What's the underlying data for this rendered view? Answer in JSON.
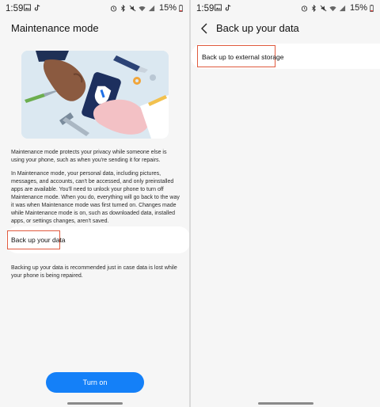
{
  "status": {
    "time": "1:59",
    "battery": "15%"
  },
  "left": {
    "title": "Maintenance mode",
    "description_1": "Maintenance mode protects your privacy while someone else is using your phone, such as when you're sending it for repairs.",
    "description_2": "In Maintenance mode, your personal data, including pictures, messages, and accounts, can't be accessed, and only preinstalled apps are available. You'll need to unlock your phone to turn off Maintenance mode. When you do, everything will go back to the way it was when Maintenance mode was first turned on. Changes made while Maintenance mode is on, such as downloaded data, installed apps, or settings changes, aren't saved.",
    "backup_label": "Back up your data",
    "backup_note": "Backing up your data is recommended just in case data is lost while your phone is being repaired.",
    "turn_on_label": "Turn on"
  },
  "right": {
    "title": "Back up your data",
    "external_label": "Back up to external storage"
  },
  "icons": [
    "gallery-icon",
    "tiktok-icon",
    "alarm-icon",
    "bluetooth-icon",
    "mute-icon",
    "wifi-icon",
    "signal-icon",
    "battery-icon",
    "back-arrow-icon"
  ],
  "colors": {
    "accent": "#1480f8",
    "highlight": "#e05a3e",
    "background": "#f6f6f6"
  }
}
